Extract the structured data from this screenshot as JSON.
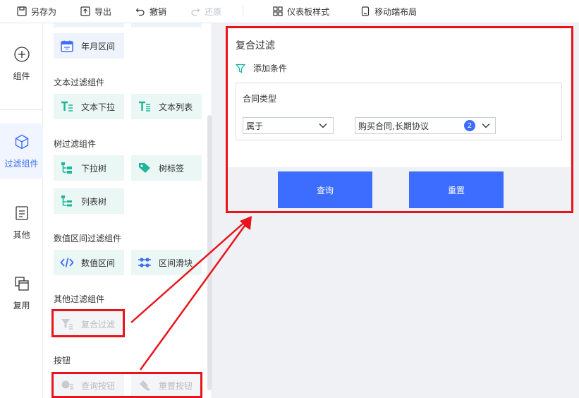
{
  "toolbar": {
    "save_as": "另存为",
    "export": "导出",
    "undo": "撤销",
    "redo": "还原",
    "dashboard_style": "仪表板样式",
    "mobile_layout": "移动端布局"
  },
  "rail": {
    "components": "组件",
    "filter_components": "过滤组件",
    "other": "其他",
    "reuse": "复用"
  },
  "panel": {
    "year_month_range": "年月区间",
    "text_filter_group": "文本过滤组件",
    "text_dropdown": "文本下拉",
    "text_list": "文本列表",
    "tree_filter_group": "树过滤组件",
    "dropdown_tree": "下拉树",
    "tree_tag": "树标签",
    "list_tree": "列表树",
    "numeric_range_group": "数值区间过滤组件",
    "numeric_range": "数值区间",
    "range_slider": "区间滑块",
    "other_filter_group": "其他过滤组件",
    "compound_filter": "复合过滤",
    "button_group": "按钮",
    "query_button": "查询按钮",
    "reset_button": "重置按钮"
  },
  "canvas": {
    "card_title": "复合过滤",
    "add_condition": "添加条件",
    "condition_label": "合同类型",
    "operator_value": "属于",
    "values_text": "购买合同,长期协议",
    "values_count": "2",
    "query": "查询",
    "reset": "重置"
  },
  "colors": {
    "accent": "#3d6dff",
    "annotation": "#e8141c",
    "teal": "#1fb59a"
  }
}
